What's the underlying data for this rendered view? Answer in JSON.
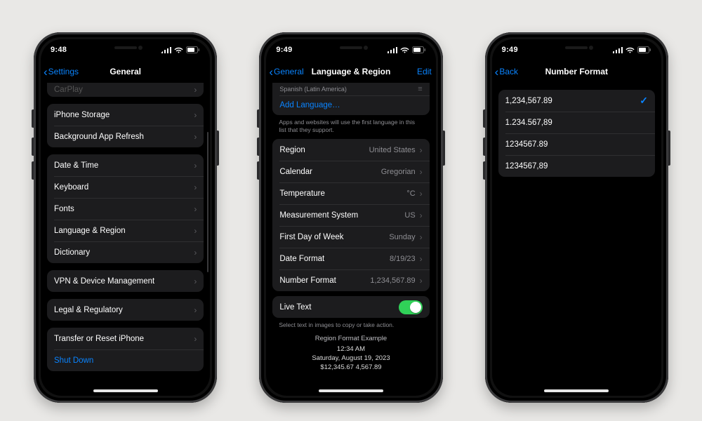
{
  "status": {
    "time": "9:48",
    "time2": "9:49",
    "time3": "9:49"
  },
  "phone1": {
    "backLabel": "Settings",
    "title": "General",
    "clippedRow": "CarPlay",
    "groups": [
      [
        "iPhone Storage",
        "Background App Refresh"
      ],
      [
        "Date & Time",
        "Keyboard",
        "Fonts",
        "Language & Region",
        "Dictionary"
      ],
      [
        "VPN & Device Management"
      ],
      [
        "Legal & Regulatory"
      ]
    ],
    "lastGroup": {
      "row": "Transfer or Reset iPhone",
      "link": "Shut Down"
    }
  },
  "phone2": {
    "backLabel": "General",
    "title": "Language & Region",
    "editLabel": "Edit",
    "langSubtitle": "Spanish (Latin America)",
    "addLanguage": "Add Language…",
    "langFooter": "Apps and websites will use the first language in this list that they support.",
    "kv": [
      {
        "k": "Region",
        "v": "United States"
      },
      {
        "k": "Calendar",
        "v": "Gregorian"
      },
      {
        "k": "Temperature",
        "v": "°C"
      },
      {
        "k": "Measurement System",
        "v": "US"
      },
      {
        "k": "First Day of Week",
        "v": "Sunday"
      },
      {
        "k": "Date Format",
        "v": "8/19/23"
      },
      {
        "k": "Number Format",
        "v": "1,234,567.89"
      }
    ],
    "liveText": "Live Text",
    "liveTextFooter": "Select text in images to copy or take action.",
    "example": {
      "header": "Region Format Example",
      "l1": "12:34 AM",
      "l2": "Saturday, August 19, 2023",
      "l3": "$12,345.67   4,567.89"
    }
  },
  "phone3": {
    "backLabel": "Back",
    "title": "Number Format",
    "options": [
      "1,234,567.89",
      "1.234.567,89",
      "1234567.89",
      "1234567,89"
    ],
    "selectedIndex": 0
  }
}
